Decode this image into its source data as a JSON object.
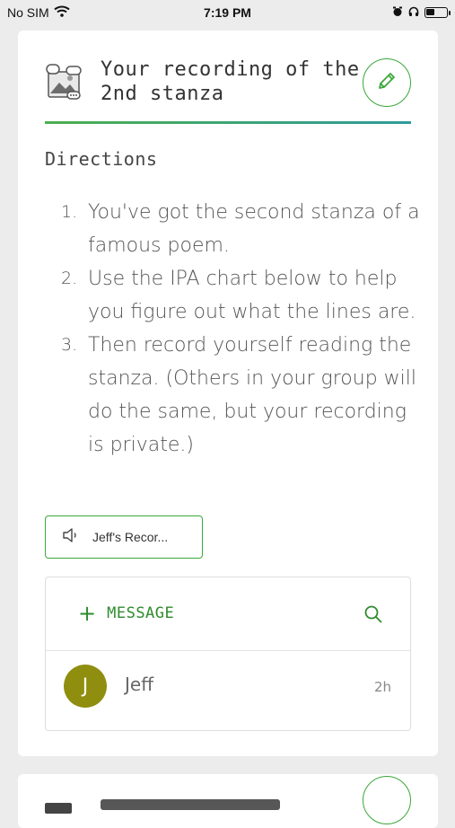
{
  "status_bar": {
    "carrier": "No SIM",
    "time": "7:19 PM",
    "battery_level": 0.4
  },
  "card": {
    "title": "Your recording of the 2nd stanza",
    "header_icon": "media-gallery-icon",
    "edit_icon": "pencil-icon",
    "directions_heading": "Directions",
    "steps": [
      {
        "num": "1.",
        "text": "You've got the second stanza of a famous poem."
      },
      {
        "num": "2.",
        "text": "Use the IPA chart below to help you figure out what the lines are."
      },
      {
        "num": "3.",
        "text": "Then record yourself reading the stanza. (Others in your group will do the same, but your recording is private.)"
      }
    ],
    "recording_label": "Jeff's Recor...",
    "recording_icon": "speaker-icon"
  },
  "messages": {
    "add_label": "MESSAGE",
    "search_icon": "search-icon",
    "items": [
      {
        "initial": "J",
        "name": "Jeff",
        "time": "2h"
      }
    ]
  },
  "colors": {
    "accent": "#3aa83a",
    "avatar": "#8f8e0e"
  }
}
